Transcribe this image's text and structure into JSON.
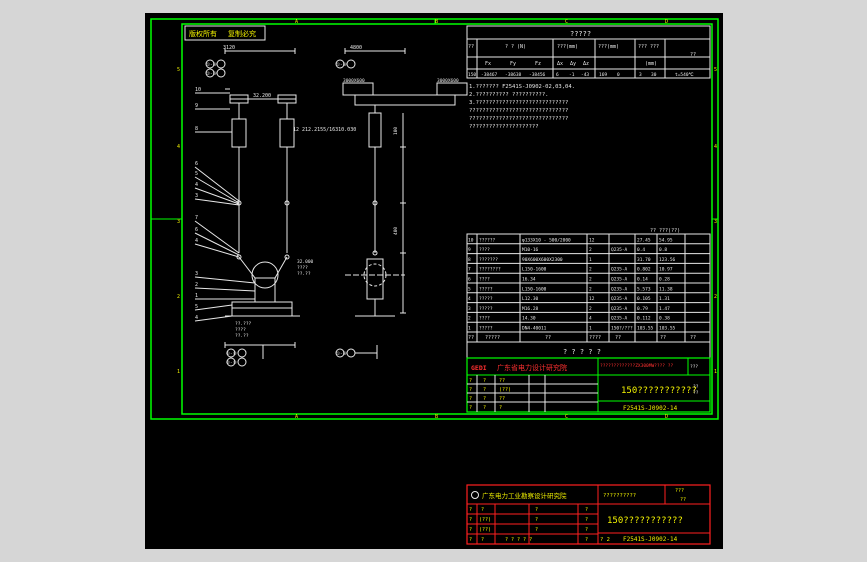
{
  "stamp": {
    "left": "版权所有",
    "right": "复制必究"
  },
  "main_drawing": {
    "dims": {
      "left_top": "3120",
      "right_top": "4800",
      "right_frame": "3000X600",
      "right_frame2": "3000X600",
      "left_elev": "32.200",
      "mid_label": "12 212.2155/16310.030",
      "offsets": [
        "100",
        "400"
      ]
    },
    "axis_tags": {
      "top_left_a": "①-⑧",
      "top_left_b": "②-⑨",
      "top_right": "①-⑧",
      "bottom_left_a": "①-⑧",
      "bottom_left_b": "②-⑨",
      "bottom_right": "①-⑧"
    },
    "part_numbers": [
      "10",
      "9",
      "8",
      "6",
      "5",
      "4",
      "3",
      "7",
      "6",
      "4",
      "3",
      "2",
      "1",
      "5",
      "4"
    ],
    "notes_left": [
      "32.000",
      "????",
      "??.??"
    ],
    "notes_bottom": [
      "??.???",
      "????",
      "??.??"
    ]
  },
  "top_table": {
    "title": "?????",
    "headers": [
      "??",
      "? ? (N)",
      "???(mm)",
      "???(mm)",
      "???\n???",
      "??"
    ],
    "subheaders": [
      "Fx",
      "Fy",
      "Fz",
      "Δx",
      "Δy",
      "Δz",
      "(mm)"
    ],
    "row": [
      "150",
      "-38467",
      "-38638",
      "-38456",
      "6",
      "-1",
      "-43",
      "169",
      "0",
      "3",
      "30",
      "t=540℃"
    ]
  },
  "notes": [
    "1.??????? F2541S-J0902-02,03,04.",
    "2.?????????? ??????????.",
    "3.????????????????????????????",
    "  ??????????????????????????????",
    "  ??????????????????????????????",
    "  ?????????????????????"
  ],
  "bom": {
    "caption": "?? ???(??)",
    "rows": [
      [
        "10",
        "??????",
        "φ133X10 - 500/2000",
        "12",
        "",
        "27.45",
        "54.95"
      ],
      [
        "9",
        "????",
        "M10-16",
        "2",
        "Q235-A",
        "0.4",
        "0.8"
      ],
      [
        "8",
        "???????",
        "90X600X600X2300",
        "1",
        "",
        "31.70",
        "123.56"
      ],
      [
        "7",
        "????????",
        "L150-1600",
        "2",
        "Q235-A",
        "0.802",
        "10.97"
      ],
      [
        "6",
        "????",
        "16.34",
        "2",
        "Q235-A",
        "0.14",
        "0.28"
      ],
      [
        "5",
        "?????",
        "L150-1600",
        "2",
        "Q235-A",
        "5.573",
        "11.38"
      ],
      [
        "4",
        "?????",
        "L12.30",
        "12",
        "Q235-A",
        "0.105",
        "1.31"
      ],
      [
        "3",
        "?????",
        "M16.28",
        "2",
        "Q235-A",
        "0.79",
        "1.47"
      ],
      [
        "2",
        "????",
        "14.30",
        "4",
        "Q235-A",
        "0.112",
        "0.38"
      ],
      [
        "1",
        "?????",
        "DN4-40011",
        "1",
        "150?/???",
        "103.55",
        "103.55"
      ]
    ],
    "footer": [
      "??",
      "?????",
      "??",
      "????",
      "?? ",
      "??",
      "??"
    ]
  },
  "title_block_1": {
    "header": "? ? ? ? ?",
    "logo": "GEDI",
    "institute": "广东省电力设计研究院",
    "project_code": "?????????????ZX300MW???? ?? ",
    "stage": "???",
    "rows": [
      [
        "?",
        "?",
        "??"
      ],
      [
        "?",
        "?",
        "(??)"
      ],
      [
        "?",
        "?",
        "??"
      ],
      [
        "?",
        "?",
        "?"
      ]
    ],
    "title": "150???????????",
    "dwg_no": "F2541S-J0902-14",
    "scale": "??",
    "sheet": "??"
  },
  "title_block_2": {
    "institute": "广东电力工业勘察设计研究院",
    "project": "??????????",
    "stage": "???",
    "code": "??",
    "rows": [
      [
        "?",
        "?",
        "",
        "?",
        "?"
      ],
      [
        "?",
        "(??)",
        "",
        "?",
        "?"
      ],
      [
        "?",
        "(??)",
        "",
        "?",
        "?"
      ],
      [
        "?",
        "?",
        "? ? ? ? ?",
        "?",
        "?"
      ]
    ],
    "title": "150???????????",
    "sheet_no": "? 2",
    "dwg_no": "F2541S-J0902-14"
  },
  "border_marks": {
    "left": [
      "5",
      "4",
      "3",
      "2",
      "1"
    ],
    "right": [
      "5",
      "4",
      "3",
      "2",
      "1"
    ],
    "top": [
      "A",
      "B",
      "C",
      "D"
    ],
    "bottom": [
      "A",
      "B",
      "C",
      "D"
    ]
  },
  "colors": {
    "frame": "#00ff00",
    "line": "#e8e8e8",
    "text": "#f2f200",
    "accent": "#ff2020",
    "background": "#000000"
  }
}
